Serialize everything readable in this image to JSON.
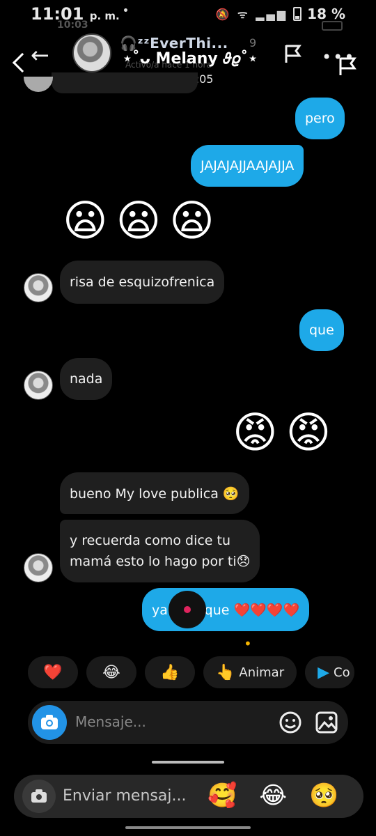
{
  "status": {
    "time": "11:01",
    "ampm": "p. m.",
    "battery": "18 %",
    "ghost_time": "10:03"
  },
  "header": {
    "username": "🎧ᶻᶻEverThi...",
    "follower_count": "9",
    "name": "⋆˚ᴗ Melany 𝜗𝜚˚⋆",
    "subtitle": "Activo/a hace 1 hora",
    "time": "Hoy 22:05"
  },
  "messages": [
    {
      "side": "sent",
      "text": "pero"
    },
    {
      "side": "sent",
      "text": "JAJAJAJJAAJAJJA"
    },
    {
      "side": "sent",
      "emoji": [
        "😦",
        "😦",
        "😦"
      ]
    },
    {
      "side": "recv",
      "text": "risa de esquizofrenica"
    },
    {
      "side": "sent",
      "text": "que"
    },
    {
      "side": "recv",
      "text": "nada"
    },
    {
      "side": "sent",
      "emoji": [
        "😡",
        "😡"
      ]
    },
    {
      "side": "recv",
      "text": "bueno My love publica 🥺"
    },
    {
      "side": "recv",
      "text": "y recuerda como dice tu",
      "text2": "mamá esto lo hago por ti😞"
    },
    {
      "side": "sent",
      "text": "ya publique ❤️❤️❤️❤️"
    }
  ],
  "reactions": [
    {
      "icon": "❤️"
    },
    {
      "icon": "😂"
    },
    {
      "icon": "👍"
    },
    {
      "icon": "👆",
      "label": "Animar"
    },
    {
      "icon": "▶",
      "label": "Co"
    }
  ],
  "compose": {
    "placeholder": "Mensaje..."
  },
  "outer_reply": {
    "placeholder": "Enviar mensaj...",
    "emojis": [
      "🥰",
      "😂",
      "🥺"
    ]
  },
  "colors": {
    "sent_bubble": "#1ea9e8",
    "recv_bubble": "#1f1f1f",
    "camera_button": "#2293e6",
    "background": "#000000"
  }
}
